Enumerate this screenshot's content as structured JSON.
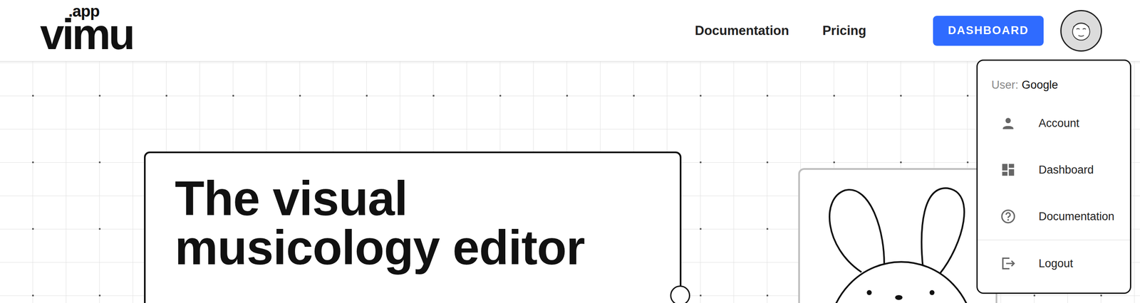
{
  "logo": {
    "suffix": ".app",
    "name": "vimu"
  },
  "nav": [
    {
      "label": "Documentation"
    },
    {
      "label": "Pricing"
    }
  ],
  "dashboard_button": {
    "label": "DASHBOARD"
  },
  "hero": {
    "title": "The visual musicology editor"
  },
  "user_menu": {
    "open": true,
    "user_label": "User:",
    "user_name": "Google",
    "items": [
      {
        "label": "Account"
      },
      {
        "label": "Dashboard"
      },
      {
        "label": "Documentation"
      }
    ],
    "footer_items": [
      {
        "label": "Logout"
      }
    ]
  }
}
